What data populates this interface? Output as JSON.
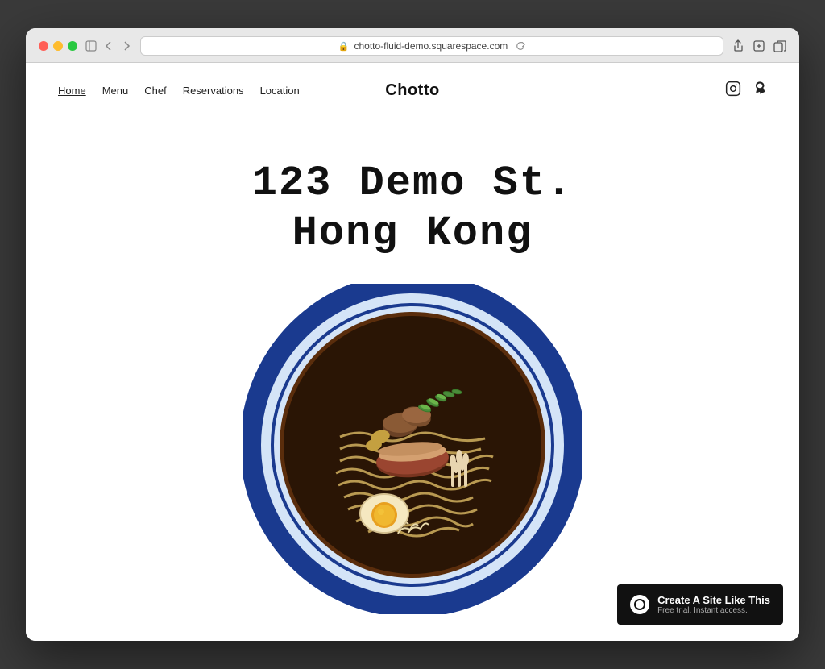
{
  "browser": {
    "url": "chotto-fluid-demo.squarespace.com",
    "reload_icon": "↺"
  },
  "nav": {
    "items": [
      {
        "label": "Home",
        "active": true
      },
      {
        "label": "Menu",
        "active": false
      },
      {
        "label": "Chef",
        "active": false
      },
      {
        "label": "Reservations",
        "active": false
      },
      {
        "label": "Location",
        "active": false
      }
    ],
    "brand": "Chotto",
    "instagram_icon": "instagram",
    "yelp_icon": "yelp"
  },
  "hero": {
    "line1": "123 Demo St.",
    "line2": "Hong Kong"
  },
  "banner": {
    "title": "Create A Site Like This",
    "subtitle": "Free trial. Instant access."
  }
}
